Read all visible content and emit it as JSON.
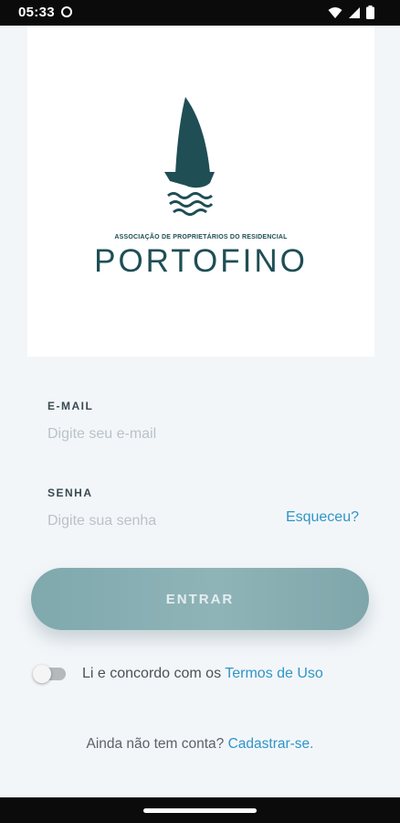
{
  "status_bar": {
    "time": "05:33"
  },
  "logo": {
    "subtitle": "ASSOCIAÇÃO DE PROPRIETÁRIOS DO RESIDENCIAL",
    "title": "PORTOFINO",
    "brand_color": "#1f4e55"
  },
  "form": {
    "email": {
      "label": "E-MAIL",
      "placeholder": "Digite seu e-mail",
      "value": ""
    },
    "password": {
      "label": "SENHA",
      "placeholder": "Digite sua senha",
      "value": ""
    },
    "forgot_label": "Esqueceu?",
    "login_label": "ENTRAR"
  },
  "terms": {
    "text": "Li e concordo com os ",
    "link": "Termos de Uso",
    "accepted": false
  },
  "signup": {
    "text": "Ainda não tem conta? ",
    "link": "Cadastrar-se."
  },
  "colors": {
    "accent": "#2f95c8",
    "button": "#8fb4b8",
    "background": "#f3f6f9"
  }
}
